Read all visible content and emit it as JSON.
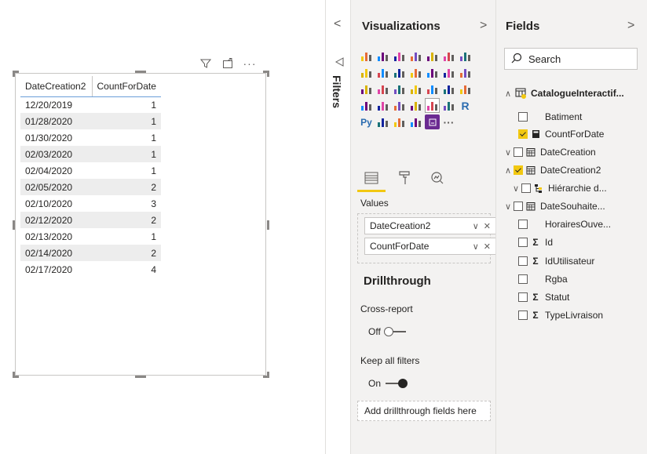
{
  "table": {
    "columns": [
      "DateCreation2",
      "CountForDate"
    ],
    "rows": [
      [
        "12/20/2019",
        "1"
      ],
      [
        "01/28/2020",
        "1"
      ],
      [
        "01/30/2020",
        "1"
      ],
      [
        "02/03/2020",
        "1"
      ],
      [
        "02/04/2020",
        "1"
      ],
      [
        "02/05/2020",
        "2"
      ],
      [
        "02/10/2020",
        "3"
      ],
      [
        "02/12/2020",
        "2"
      ],
      [
        "02/13/2020",
        "1"
      ],
      [
        "02/14/2020",
        "2"
      ],
      [
        "02/17/2020",
        "4"
      ]
    ]
  },
  "filters": {
    "label": "Filters",
    "collapse_glyph": "<"
  },
  "viz": {
    "title": "Visualizations",
    "collapse_glyph": ">",
    "values_label": "Values",
    "value_fields": [
      "DateCreation2",
      "CountForDate"
    ],
    "drillthrough_title": "Drillthrough",
    "cross_report_label": "Cross-report",
    "cross_report_state": "Off",
    "keep_filters_label": "Keep all filters",
    "keep_filters_state": "On",
    "drop_label": "Add drillthrough fields here",
    "icons": [
      "stacked-bar-icon",
      "stacked-column-icon",
      "clustered-bar-icon",
      "clustered-column-icon",
      "100-bar-icon",
      "100-column-icon",
      "line-chart-icon",
      "area-chart-icon",
      "stacked-area-icon",
      "line-column-icon",
      "line-clustered-icon",
      "ribbon-chart-icon",
      "waterfall-icon",
      "funnel-icon",
      "scatter-icon",
      "pie-chart-icon",
      "donut-chart-icon",
      "treemap-icon",
      "map-icon",
      "filled-map-icon",
      "gauge-icon",
      "card-icon",
      "multi-row-card-icon",
      "kpi-icon",
      "slicer-icon",
      "table-icon",
      "matrix-icon",
      "r-visual-icon",
      "python-visual-icon",
      "key-influencers-icon",
      "qa-icon",
      "globe-icon",
      "custom-visual-icon",
      "more-icon"
    ],
    "icon_glyphs": {
      "r-visual-icon": "R",
      "python-visual-icon": "Py",
      "more-icon": "···"
    }
  },
  "fields": {
    "title": "Fields",
    "collapse_glyph": ">",
    "search_placeholder": "Search",
    "table_name": "CatalogueInteractif...",
    "items": [
      {
        "label": "Batiment",
        "checked": false,
        "icon": "",
        "expander": ""
      },
      {
        "label": "CountForDate",
        "checked": true,
        "icon": "calculator-icon",
        "expander": ""
      },
      {
        "label": "DateCreation",
        "checked": false,
        "icon": "calendar-icon",
        "expander": "v"
      },
      {
        "label": "DateCreation2",
        "checked": true,
        "icon": "calendar-icon",
        "expander": "^"
      },
      {
        "label": "Hiérarchie d...",
        "checked": false,
        "icon": "hierarchy-icon",
        "expander": "v"
      },
      {
        "label": "DateSouhaite...",
        "checked": false,
        "icon": "calendar-icon",
        "expander": "v"
      },
      {
        "label": "HorairesOuve...",
        "checked": false,
        "icon": "",
        "expander": ""
      },
      {
        "label": "Id",
        "checked": false,
        "icon": "sigma-icon",
        "expander": ""
      },
      {
        "label": "IdUtilisateur",
        "checked": false,
        "icon": "sigma-icon",
        "expander": ""
      },
      {
        "label": "Rgba",
        "checked": false,
        "icon": "",
        "expander": ""
      },
      {
        "label": "Statut",
        "checked": false,
        "icon": "sigma-icon",
        "expander": ""
      },
      {
        "label": "TypeLivraison",
        "checked": false,
        "icon": "sigma-icon",
        "expander": ""
      }
    ]
  },
  "colors": {
    "accent": "#f2c811",
    "pane_bg": "#f3f2f1",
    "row_alt": "#ededed",
    "header_line": "#6b9ed8"
  }
}
